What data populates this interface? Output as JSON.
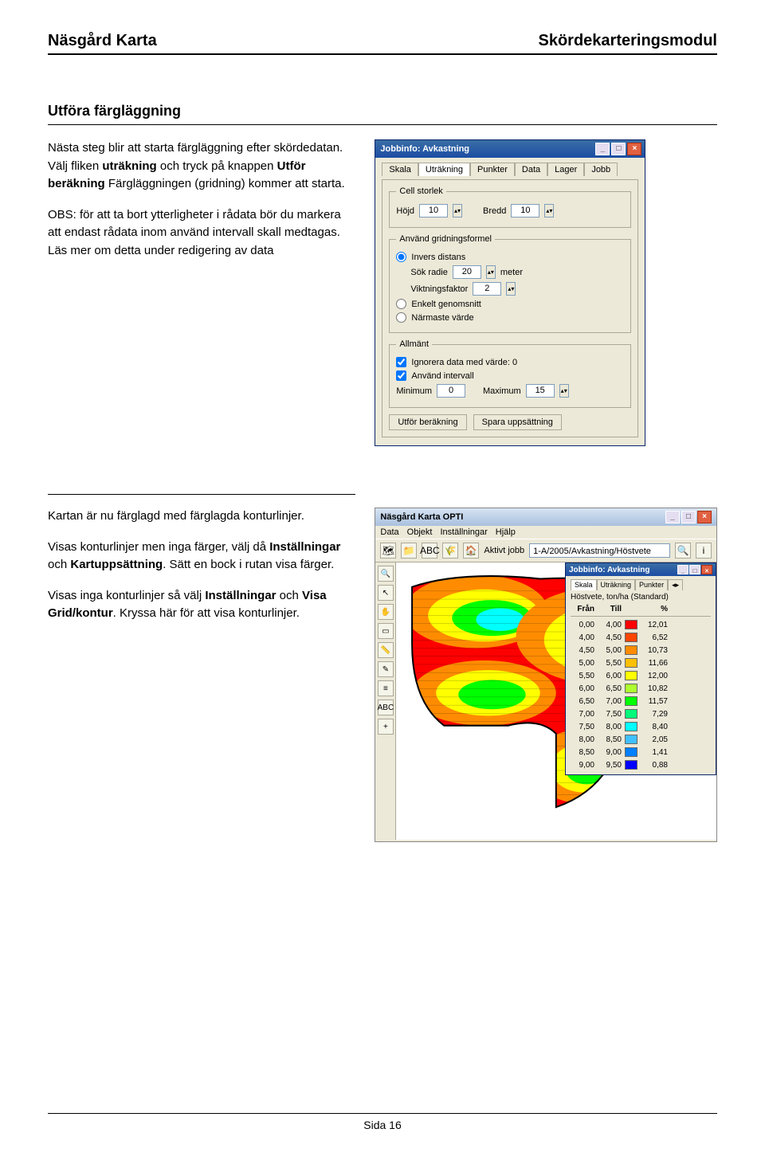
{
  "header": {
    "left": "Näsgård Karta",
    "right": "Skördekarteringsmodul"
  },
  "section1": {
    "title": "Utföra färgläggning",
    "p1_a": "Nästa steg blir att starta färgläggning efter skördedatan. Välj fliken ",
    "p1_b": "uträkning",
    "p1_c": " och tryck på knappen ",
    "p1_d": "Utför beräkning",
    "p1_e": " Färgläggningen (gridning) kommer att starta.",
    "p2": "OBS: för att ta bort ytterligheter i rådata bör du markera att endast rådata inom använd intervall skall medtagas. Läs mer om detta under redigering av data"
  },
  "dialog": {
    "title": "Jobbinfo: Avkastning",
    "tabs": [
      "Skala",
      "Uträkning",
      "Punkter",
      "Data",
      "Lager",
      "Jobb"
    ],
    "active_tab": 1,
    "group_cell": "Cell storlek",
    "lbl_hojd": "Höjd",
    "val_hojd": "10",
    "lbl_bredd": "Bredd",
    "val_bredd": "10",
    "group_grid": "Använd gridningsformel",
    "radio_invers": "Invers distans",
    "lbl_sokradie": "Sök radie",
    "val_sokradie": "20",
    "unit_meter": "meter",
    "lbl_vikt": "Viktningsfaktor",
    "val_vikt": "2",
    "radio_enkelt": "Enkelt genomsnitt",
    "radio_narmaste": "Närmaste värde",
    "group_allmant": "Allmänt",
    "chk_ignorera": "Ignorera data med värde: 0",
    "chk_intervall": "Använd intervall",
    "lbl_min": "Minimum",
    "val_min": "0",
    "lbl_max": "Maximum",
    "val_max": "15",
    "btn_calc": "Utför beräkning",
    "btn_save": "Spara uppsättning"
  },
  "section2": {
    "p1": "Kartan är nu färglagd med färglagda konturlinjer.",
    "p2_a": "Visas konturlinjer men inga färger, välj då ",
    "p2_b": "Inställningar",
    "p2_c": " och ",
    "p2_d": "Kartuppsättning",
    "p2_e": ". Sätt en bock i rutan visa färger.",
    "p3_a": "Visas inga konturlinjer så välj ",
    "p3_b": "Inställningar",
    "p3_c": " och ",
    "p3_d": "Visa Grid/kontur",
    "p3_e": ". Kryssa här för att visa konturlinjer."
  },
  "app": {
    "title": "Näsgård Karta OPTI",
    "menu": [
      "Data",
      "Objekt",
      "Inställningar",
      "Hjälp"
    ],
    "active_label": "Aktivt jobb",
    "active_value": "1-A/2005/Avkastning/Höstvete",
    "legend": {
      "title": "Jobbinfo: Avkastning",
      "tabs": [
        "Skala",
        "Uträkning",
        "Punkter"
      ],
      "subtitle": "Höstvete, ton/ha (Standard)",
      "head_from": "Från",
      "head_to": "Till",
      "head_pct": "%",
      "rows": [
        {
          "from": "0,00",
          "to": "4,00",
          "color": "#ff0000",
          "pct": "12,01"
        },
        {
          "from": "4,00",
          "to": "4,50",
          "color": "#ff4500",
          "pct": "6,52"
        },
        {
          "from": "4,50",
          "to": "5,00",
          "color": "#ff8c00",
          "pct": "10,73"
        },
        {
          "from": "5,00",
          "to": "5,50",
          "color": "#ffc000",
          "pct": "11,66"
        },
        {
          "from": "5,50",
          "to": "6,00",
          "color": "#ffff00",
          "pct": "12,00"
        },
        {
          "from": "6,00",
          "to": "6,50",
          "color": "#adff2f",
          "pct": "10,82"
        },
        {
          "from": "6,50",
          "to": "7,00",
          "color": "#00ff00",
          "pct": "11,57"
        },
        {
          "from": "7,00",
          "to": "7,50",
          "color": "#00fa7a",
          "pct": "7,29"
        },
        {
          "from": "7,50",
          "to": "8,00",
          "color": "#00ffff",
          "pct": "8,40"
        },
        {
          "from": "8,00",
          "to": "8,50",
          "color": "#40c0ff",
          "pct": "2,05"
        },
        {
          "from": "8,50",
          "to": "9,00",
          "color": "#0080ff",
          "pct": "1,41"
        },
        {
          "from": "9,00",
          "to": "9,50",
          "color": "#0000ff",
          "pct": "0,88"
        }
      ]
    }
  },
  "footer": "Sida 16"
}
